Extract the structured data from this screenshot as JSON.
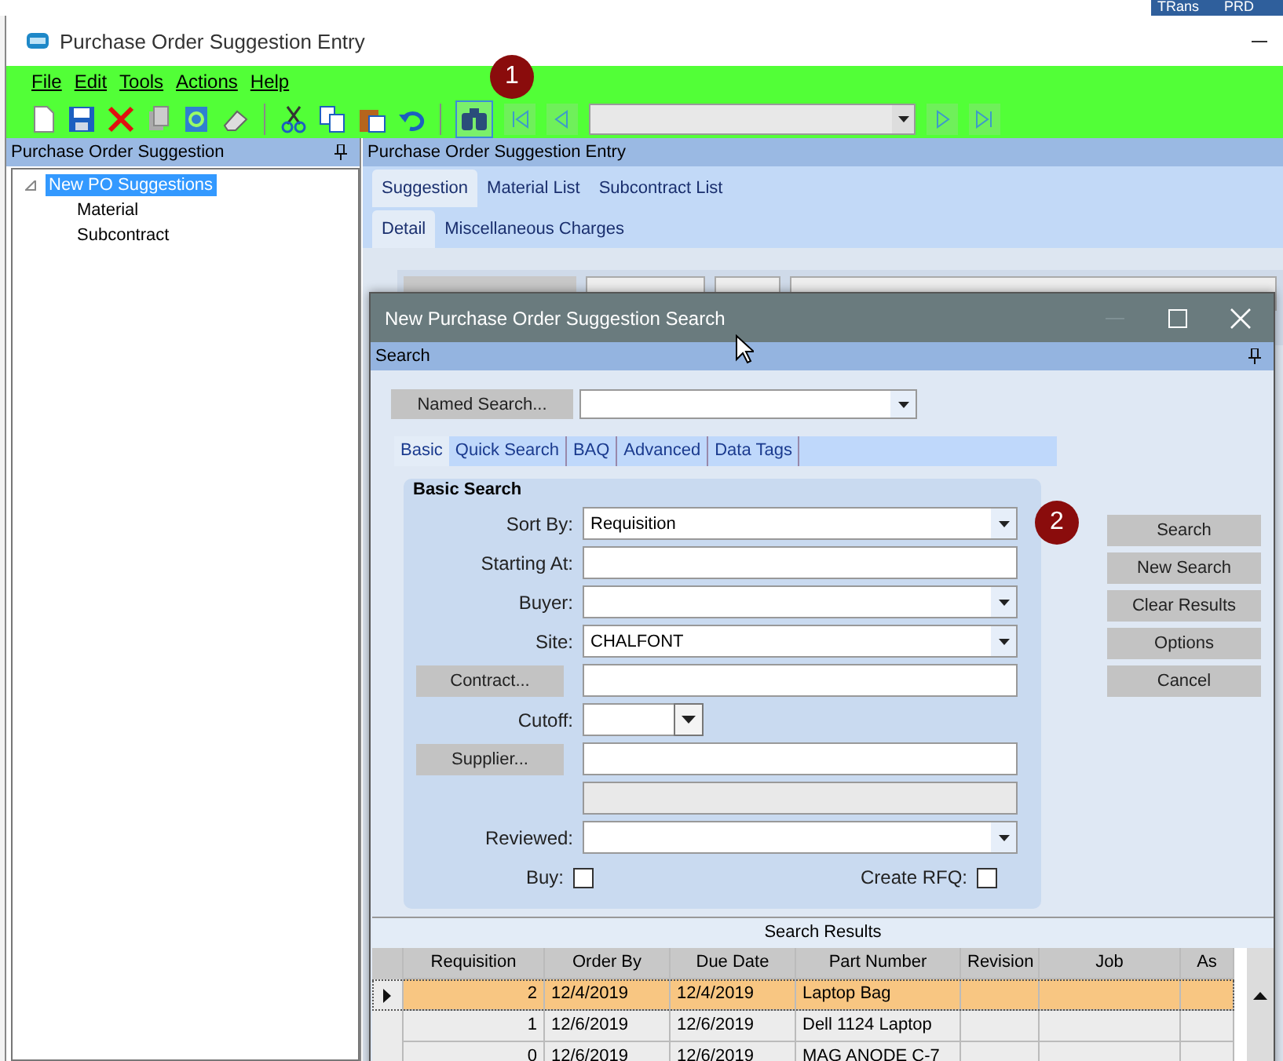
{
  "background_window": {
    "labels": [
      "TRans",
      "PRD"
    ]
  },
  "window": {
    "title": "Purchase Order Suggestion Entry"
  },
  "menu": [
    "File",
    "Edit",
    "Tools",
    "Actions",
    "Help"
  ],
  "toolbar": {
    "callout": "1"
  },
  "tree_panel": {
    "title": "Purchase Order Suggestion",
    "items": [
      {
        "label": "New PO Suggestions",
        "selected": true,
        "expanded": true,
        "children": [
          {
            "label": "Material",
            "selected": false
          },
          {
            "label": "Subcontract",
            "selected": false
          }
        ]
      }
    ]
  },
  "entry_panel": {
    "title": "Purchase Order Suggestion Entry",
    "tabs": [
      {
        "label": "Suggestion",
        "selected": true
      },
      {
        "label": "Material List",
        "selected": false
      },
      {
        "label": "Subcontract List",
        "selected": false
      }
    ],
    "subtabs": [
      {
        "label": "Detail",
        "selected": true
      },
      {
        "label": "Miscellaneous Charges",
        "selected": false
      }
    ]
  },
  "dialog": {
    "title": "New Purchase Order Suggestion Search",
    "pane_title": "Search",
    "named_search": "Named Search...",
    "tabs": [
      {
        "label": "Basic",
        "selected": true
      },
      {
        "label": "Quick Search",
        "selected": false
      },
      {
        "label": "BAQ",
        "selected": false
      },
      {
        "label": "Advanced",
        "selected": false
      },
      {
        "label": "Data Tags",
        "selected": false
      }
    ],
    "group_title": "Basic Search",
    "fields": [
      {
        "kind": "combo",
        "label": "Sort By:",
        "value": "Requisition",
        "callout": "2"
      },
      {
        "kind": "text",
        "label": "Starting At:"
      },
      {
        "kind": "combo",
        "label": "Buyer:"
      },
      {
        "kind": "combo",
        "label": "Site:",
        "value": "CHALFONT"
      },
      {
        "kind": "button",
        "label": "Contract..."
      },
      {
        "kind": "date",
        "label": "Cutoff:"
      },
      {
        "kind": "button",
        "label": "Supplier..."
      },
      {
        "kind": "readonly"
      },
      {
        "kind": "combo",
        "label": "Reviewed:"
      }
    ],
    "checkboxes": [
      {
        "label": "Buy:",
        "checked": false
      },
      {
        "label": "Create RFQ:",
        "checked": false
      }
    ],
    "buttons": [
      "Search",
      "New Search",
      "Clear Results",
      "Options",
      "Cancel"
    ],
    "results": {
      "title": "Search Results",
      "columns": [
        "Requisition",
        "Order By",
        "Due Date",
        "Part Number",
        "Revision",
        "Job",
        "As"
      ],
      "rows": [
        {
          "selected": true,
          "cells": [
            "2",
            "12/4/2019",
            "12/4/2019",
            "Laptop Bag",
            "",
            "",
            ""
          ]
        },
        {
          "selected": false,
          "cells": [
            "1",
            "12/6/2019",
            "12/6/2019",
            "Dell 1124 Laptop",
            "",
            "",
            ""
          ]
        },
        {
          "selected": false,
          "cells": [
            "0",
            "12/6/2019",
            "12/6/2019",
            "MAG ANODE C-7",
            "",
            "",
            ""
          ]
        }
      ]
    }
  }
}
